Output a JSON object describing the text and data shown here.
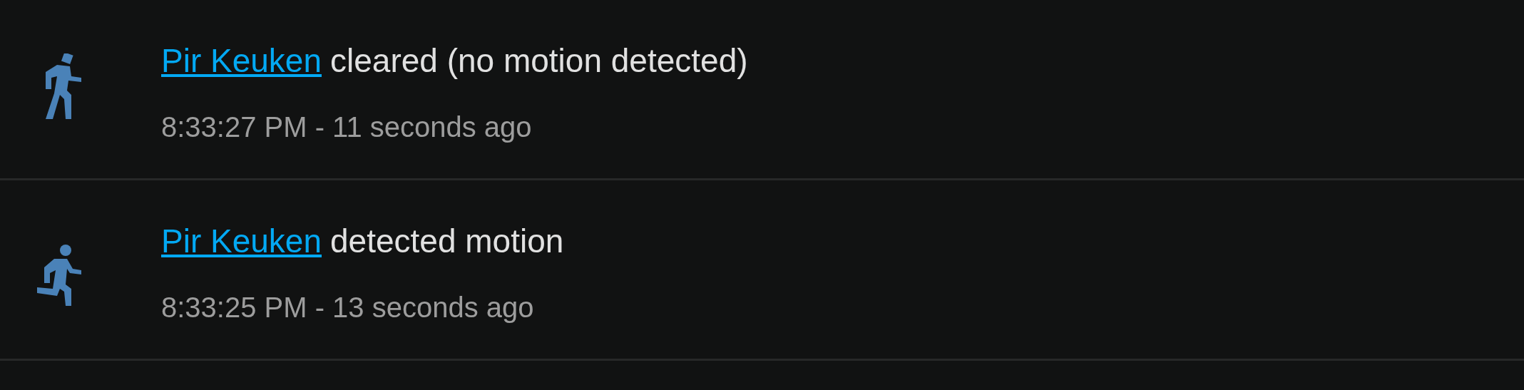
{
  "entries": [
    {
      "kind": "cleared",
      "entity": "Pir Keuken",
      "message": "cleared (no motion detected)",
      "time": "8:33:27 PM - 11 seconds ago"
    },
    {
      "kind": "detected",
      "entity": "Pir Keuken",
      "message": "detected motion",
      "time": "8:33:25 PM - 13 seconds ago"
    }
  ]
}
